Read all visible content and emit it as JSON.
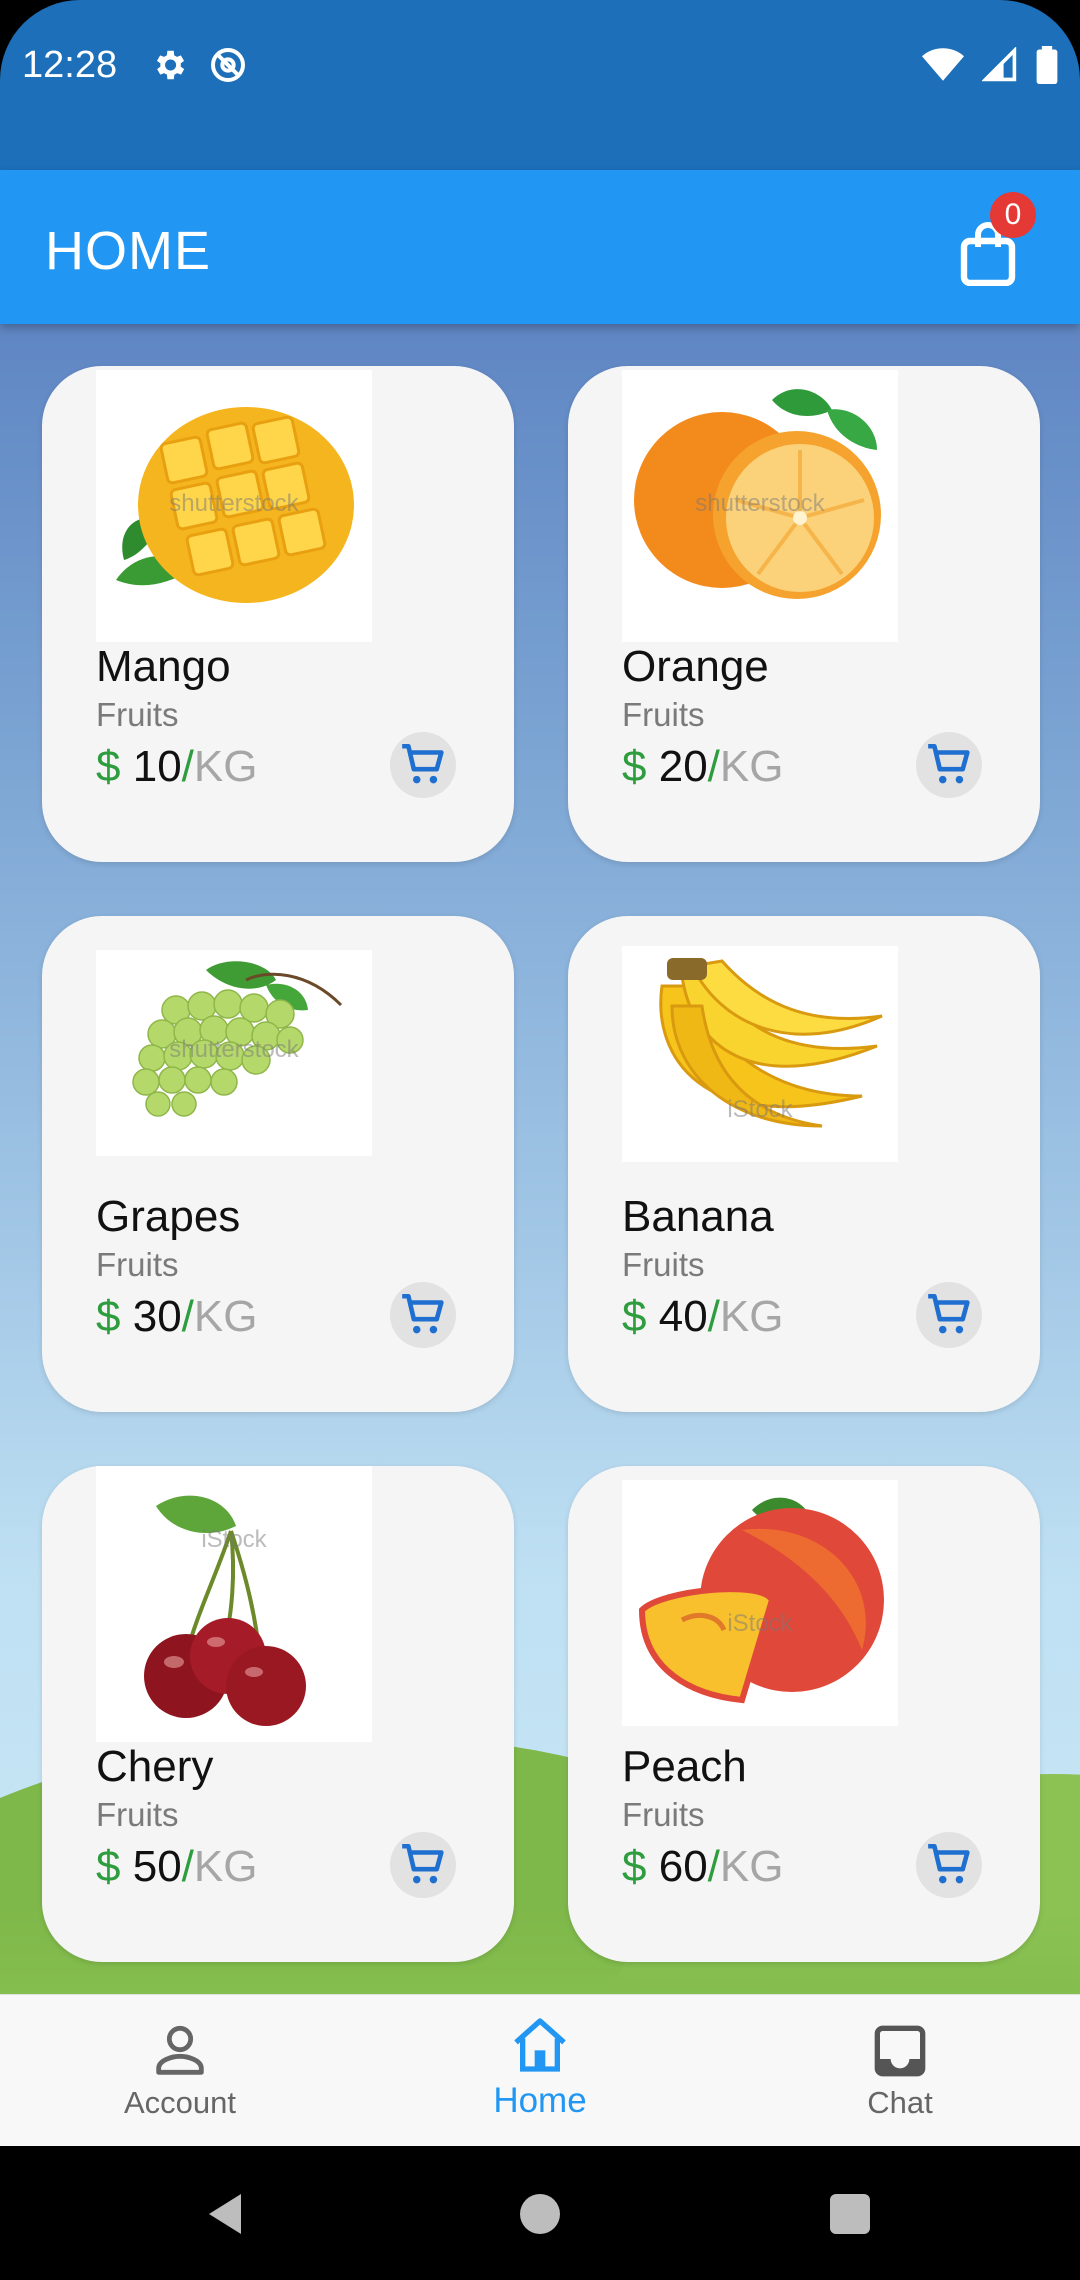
{
  "status_bar": {
    "time": "12:28",
    "icons": [
      "gear-icon",
      "at-icon",
      "wifi-icon",
      "signal-icon",
      "battery-icon"
    ]
  },
  "app_bar": {
    "title": "HOME",
    "cart_count": "0"
  },
  "products": [
    {
      "name": "Mango",
      "category": "Fruits",
      "currency": "$",
      "price": "10",
      "slash": "/",
      "unit": "KG",
      "watermark": "shutterstock"
    },
    {
      "name": "Orange",
      "category": "Fruits",
      "currency": "$",
      "price": "20",
      "slash": "/",
      "unit": "KG",
      "watermark": "shutterstock"
    },
    {
      "name": "Grapes",
      "category": "Fruits",
      "currency": "$",
      "price": "30",
      "slash": "/",
      "unit": "KG",
      "watermark": "shutterstock"
    },
    {
      "name": "Banana",
      "category": "Fruits",
      "currency": "$",
      "price": "40",
      "slash": "/",
      "unit": "KG",
      "watermark": "iStock"
    },
    {
      "name": "Chery",
      "category": "Fruits",
      "currency": "$",
      "price": "50",
      "slash": "/",
      "unit": "KG",
      "watermark": "iStock"
    },
    {
      "name": "Peach",
      "category": "Fruits",
      "currency": "$",
      "price": "60",
      "slash": "/",
      "unit": "KG",
      "watermark": "iStock"
    }
  ],
  "bottom_nav": {
    "items": [
      {
        "label": "Account",
        "icon": "person-icon"
      },
      {
        "label": "Home",
        "icon": "home-icon",
        "active": true
      },
      {
        "label": "Chat",
        "icon": "inbox-icon"
      }
    ]
  },
  "colors": {
    "status_bar": "#1c6fb8",
    "app_bar": "#2196f3",
    "accent": "#2196f3",
    "price_green": "#2e9d3e",
    "badge": "#e53935"
  }
}
